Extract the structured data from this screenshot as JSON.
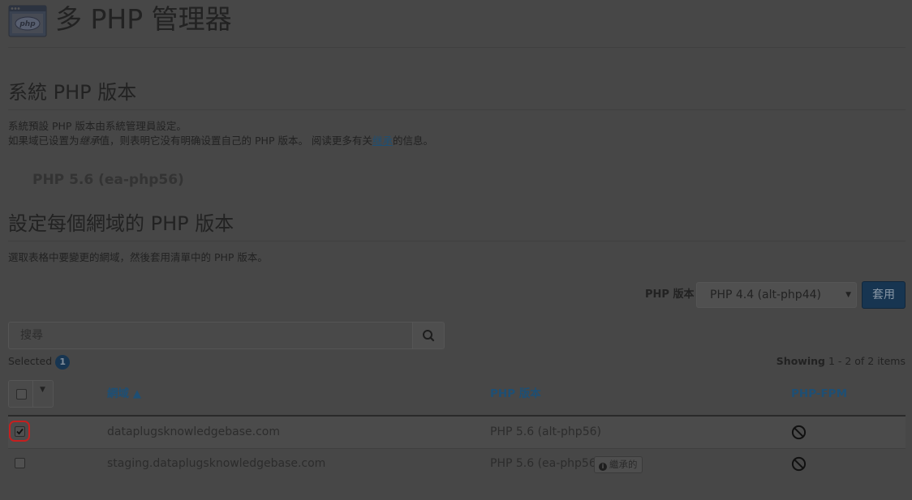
{
  "header": {
    "title": "多 PHP 管理器",
    "icon": "php-window-icon"
  },
  "system_section": {
    "heading": "系統 PHP 版本",
    "desc_line1": "系統預設 PHP 版本由系統管理員設定。",
    "desc_line2_a": "如果域已设置为",
    "desc_line2_italic": "继承",
    "desc_line2_b": "值，则表明它没有明确设置自己的 PHP 版本。 阅读更多有关",
    "desc_line2_link": "继承",
    "desc_line2_c": "的信息。",
    "current_version": "PHP 5.6 (ea-php56)"
  },
  "domain_section": {
    "heading": "設定每個網域的 PHP 版本",
    "desc": "選取表格中要變更的網域，然後套用清單中的 PHP 版本。",
    "version_label": "PHP 版本",
    "version_selected": "PHP 4.4 (alt-php44)",
    "apply_label": "套用"
  },
  "search": {
    "placeholder": "搜尋",
    "icon": "search-icon"
  },
  "selection": {
    "label": "Selected",
    "count": "1"
  },
  "paging": {
    "prefix": "Showing",
    "range": "1 - 2 of 2 items"
  },
  "table": {
    "columns": {
      "domain": "網域 ▲",
      "php_version": "PHP 版本",
      "php_fpm": "PHP-FPM"
    },
    "rows": [
      {
        "domain": "dataplugsknowledgebase.com",
        "php_version": "PHP 5.6 (alt-php56)",
        "checked": true,
        "inherited": false,
        "fpm_icon": "prohibited-icon"
      },
      {
        "domain": "staging.dataplugsknowledgebase.com",
        "php_version": "PHP 5.6 (ea-php56)",
        "checked": false,
        "inherited": true,
        "inherited_label": "繼承的",
        "fpm_icon": "prohibited-icon"
      }
    ]
  },
  "colors": {
    "overlay": "#474747",
    "link": "#1e4f74",
    "primary": "#173551",
    "focus_ring": "#c51f1f"
  }
}
